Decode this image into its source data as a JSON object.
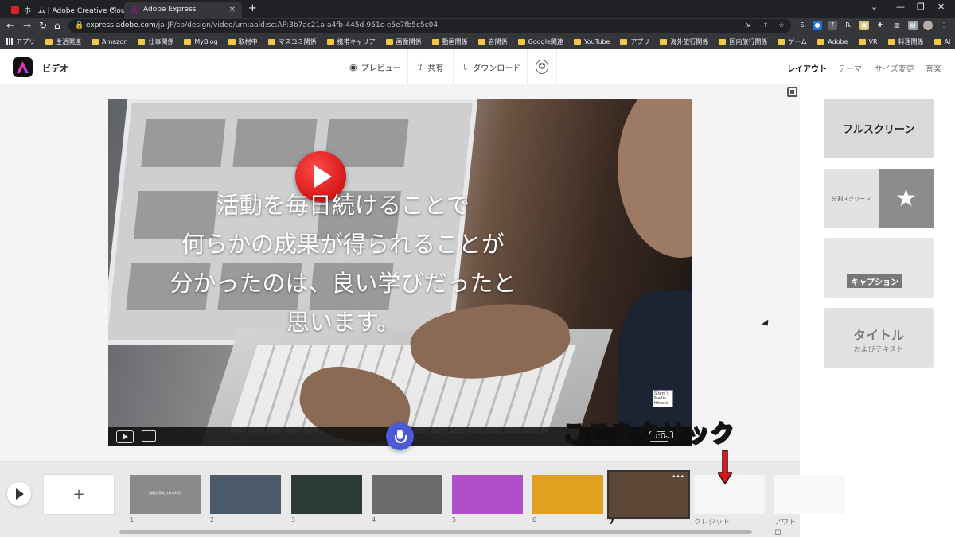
{
  "browser": {
    "tabs": [
      {
        "title": "ホーム | Adobe Creative Cloud",
        "active": false,
        "favicon_color": "#da1f26"
      },
      {
        "title": "Adobe Express",
        "active": true,
        "favicon_color": "#2c2c2c"
      }
    ],
    "new_tab_icon": "plus-icon",
    "url": {
      "host": "express.adobe.com",
      "path": "/ja-JP/sp/design/video/urn:aaid:sc:AP:3b7ac21a-a4fb-445d-951c-e5e7fb5c5c04"
    },
    "bookmarks": [
      "アプリ",
      "生活関連",
      "Amazon",
      "仕事関係",
      "MyBlog",
      "取材中",
      "マスコミ関係",
      "携帯キャリア",
      "画像関係",
      "動画関係",
      "音関係",
      "Google関連",
      "YouTube",
      "アプリ",
      "海外旅行関係",
      "国内旅行関係",
      "ゲーム",
      "Adobe",
      "VR",
      "料理関係",
      "AI"
    ]
  },
  "app": {
    "title": "ビデオ",
    "toolbar": {
      "preview": "プレビュー",
      "share": "共有",
      "download": "ダウンロード"
    },
    "right_tabs": [
      "レイアウト",
      "テーマ",
      "サイズ変更",
      "音楽"
    ]
  },
  "stage": {
    "overlay_lines": [
      "活動を毎日続けることで",
      "何らかの成果が得られることが",
      "分かったのは、良い学びだったと",
      "思います。"
    ],
    "watermark_lines": [
      "Sitem's",
      "Media",
      "Hiroshi"
    ],
    "timecode": "0:04"
  },
  "layout_panel": {
    "fullscreen": "フルスクリーン",
    "split_screen": "分割スクリーン",
    "split_icon": "★",
    "caption": "キャプション",
    "title_main": "タイトル",
    "title_sub": "およびテキスト"
  },
  "annotation": {
    "text": "ここをクリック",
    "color": "#e41414"
  },
  "timeline": {
    "add_icon": "+",
    "scenes": [
      {
        "number": "1",
        "color": "#8a8a8a",
        "text": "動画が伝えられる時代"
      },
      {
        "number": "2",
        "color": "#4a5a6a",
        "text": ""
      },
      {
        "number": "3",
        "color": "#2c3a38",
        "text": ""
      },
      {
        "number": "4",
        "color": "#6a6a6a",
        "text": ""
      },
      {
        "number": "5",
        "color": "#b04fc8",
        "text": ""
      },
      {
        "number": "6",
        "color": "#e0a020",
        "text": ""
      },
      {
        "number": "7",
        "color": "#5c4636",
        "text": "",
        "selected": true
      },
      {
        "number": "クレジット",
        "color": "#f6f6f6",
        "text": ""
      },
      {
        "number": "アウトロ",
        "color": "#f8f8f8",
        "text": ""
      }
    ]
  }
}
